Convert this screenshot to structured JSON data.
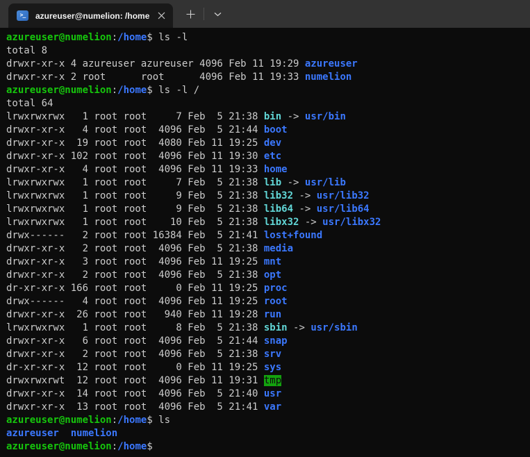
{
  "tabbar": {
    "tab_title": "azureuser@numelion: /home",
    "icons": {
      "tab": "powershell-icon",
      "close": "close-icon",
      "new_tab": "plus-icon",
      "dropdown": "chevron-down-icon"
    },
    "powershell_glyph": ">_"
  },
  "colors": {
    "terminal_background": "#0c0c0c",
    "tabbar_background": "#333333",
    "active_tab_background": "#191919",
    "foreground": "#cccccc",
    "prompt_green": "#16c60c",
    "directory_blue": "#3b78ff",
    "symlink_cyan": "#61d6d6",
    "tmp_highlight_background": "#13a10e"
  },
  "terminal": {
    "lines": [
      [
        [
          "green",
          "azureuser@numelion"
        ],
        [
          "fg",
          ":"
        ],
        [
          "blue",
          "/home"
        ],
        [
          "fg",
          "$ ls -l"
        ]
      ],
      [
        [
          "fg",
          "total 8"
        ]
      ],
      [
        [
          "fg",
          "drwxr-xr-x 4 azureuser azureuser 4096 Feb 11 19:29 "
        ],
        [
          "blue",
          "azureuser"
        ]
      ],
      [
        [
          "fg",
          "drwxr-xr-x 2 root      root      4096 Feb 11 19:33 "
        ],
        [
          "blue",
          "numelion"
        ]
      ],
      [
        [
          "green",
          "azureuser@numelion"
        ],
        [
          "fg",
          ":"
        ],
        [
          "blue",
          "/home"
        ],
        [
          "fg",
          "$ ls -l /"
        ]
      ],
      [
        [
          "fg",
          "total 64"
        ]
      ],
      [
        [
          "fg",
          "lrwxrwxrwx   1 root root     7 Feb  5 21:38 "
        ],
        [
          "cyan",
          "bin"
        ],
        [
          "fg",
          " -> "
        ],
        [
          "blue",
          "usr/bin"
        ]
      ],
      [
        [
          "fg",
          "drwxr-xr-x   4 root root  4096 Feb  5 21:44 "
        ],
        [
          "blue",
          "boot"
        ]
      ],
      [
        [
          "fg",
          "drwxr-xr-x  19 root root  4080 Feb 11 19:25 "
        ],
        [
          "blue",
          "dev"
        ]
      ],
      [
        [
          "fg",
          "drwxr-xr-x 102 root root  4096 Feb 11 19:30 "
        ],
        [
          "blue",
          "etc"
        ]
      ],
      [
        [
          "fg",
          "drwxr-xr-x   4 root root  4096 Feb 11 19:33 "
        ],
        [
          "blue",
          "home"
        ]
      ],
      [
        [
          "fg",
          "lrwxrwxrwx   1 root root     7 Feb  5 21:38 "
        ],
        [
          "cyan",
          "lib"
        ],
        [
          "fg",
          " -> "
        ],
        [
          "blue",
          "usr/lib"
        ]
      ],
      [
        [
          "fg",
          "lrwxrwxrwx   1 root root     9 Feb  5 21:38 "
        ],
        [
          "cyan",
          "lib32"
        ],
        [
          "fg",
          " -> "
        ],
        [
          "blue",
          "usr/lib32"
        ]
      ],
      [
        [
          "fg",
          "lrwxrwxrwx   1 root root     9 Feb  5 21:38 "
        ],
        [
          "cyan",
          "lib64"
        ],
        [
          "fg",
          " -> "
        ],
        [
          "blue",
          "usr/lib64"
        ]
      ],
      [
        [
          "fg",
          "lrwxrwxrwx   1 root root    10 Feb  5 21:38 "
        ],
        [
          "cyan",
          "libx32"
        ],
        [
          "fg",
          " -> "
        ],
        [
          "blue",
          "usr/libx32"
        ]
      ],
      [
        [
          "fg",
          "drwx------   2 root root 16384 Feb  5 21:41 "
        ],
        [
          "blue",
          "lost+found"
        ]
      ],
      [
        [
          "fg",
          "drwxr-xr-x   2 root root  4096 Feb  5 21:38 "
        ],
        [
          "blue",
          "media"
        ]
      ],
      [
        [
          "fg",
          "drwxr-xr-x   3 root root  4096 Feb 11 19:25 "
        ],
        [
          "blue",
          "mnt"
        ]
      ],
      [
        [
          "fg",
          "drwxr-xr-x   2 root root  4096 Feb  5 21:38 "
        ],
        [
          "blue",
          "opt"
        ]
      ],
      [
        [
          "fg",
          "dr-xr-xr-x 166 root root     0 Feb 11 19:25 "
        ],
        [
          "blue",
          "proc"
        ]
      ],
      [
        [
          "fg",
          "drwx------   4 root root  4096 Feb 11 19:25 "
        ],
        [
          "blue",
          "root"
        ]
      ],
      [
        [
          "fg",
          "drwxr-xr-x  26 root root   940 Feb 11 19:28 "
        ],
        [
          "blue",
          "run"
        ]
      ],
      [
        [
          "fg",
          "lrwxrwxrwx   1 root root     8 Feb  5 21:38 "
        ],
        [
          "cyan",
          "sbin"
        ],
        [
          "fg",
          " -> "
        ],
        [
          "blue",
          "usr/sbin"
        ]
      ],
      [
        [
          "fg",
          "drwxr-xr-x   6 root root  4096 Feb  5 21:44 "
        ],
        [
          "blue",
          "snap"
        ]
      ],
      [
        [
          "fg",
          "drwxr-xr-x   2 root root  4096 Feb  5 21:38 "
        ],
        [
          "blue",
          "srv"
        ]
      ],
      [
        [
          "fg",
          "dr-xr-xr-x  12 root root     0 Feb 11 19:25 "
        ],
        [
          "blue",
          "sys"
        ]
      ],
      [
        [
          "fg",
          "drwxrwxrwt  12 root root  4096 Feb 11 19:31 "
        ],
        [
          "tmp",
          "tmp"
        ]
      ],
      [
        [
          "fg",
          "drwxr-xr-x  14 root root  4096 Feb  5 21:40 "
        ],
        [
          "blue",
          "usr"
        ]
      ],
      [
        [
          "fg",
          "drwxr-xr-x  13 root root  4096 Feb  5 21:41 "
        ],
        [
          "blue",
          "var"
        ]
      ],
      [
        [
          "green",
          "azureuser@numelion"
        ],
        [
          "fg",
          ":"
        ],
        [
          "blue",
          "/home"
        ],
        [
          "fg",
          "$ ls"
        ]
      ],
      [
        [
          "blue",
          "azureuser"
        ],
        [
          "fg",
          "  "
        ],
        [
          "blue",
          "numelion"
        ]
      ],
      [
        [
          "green",
          "azureuser@numelion"
        ],
        [
          "fg",
          ":"
        ],
        [
          "blue",
          "/home"
        ],
        [
          "fg",
          "$"
        ]
      ]
    ]
  }
}
